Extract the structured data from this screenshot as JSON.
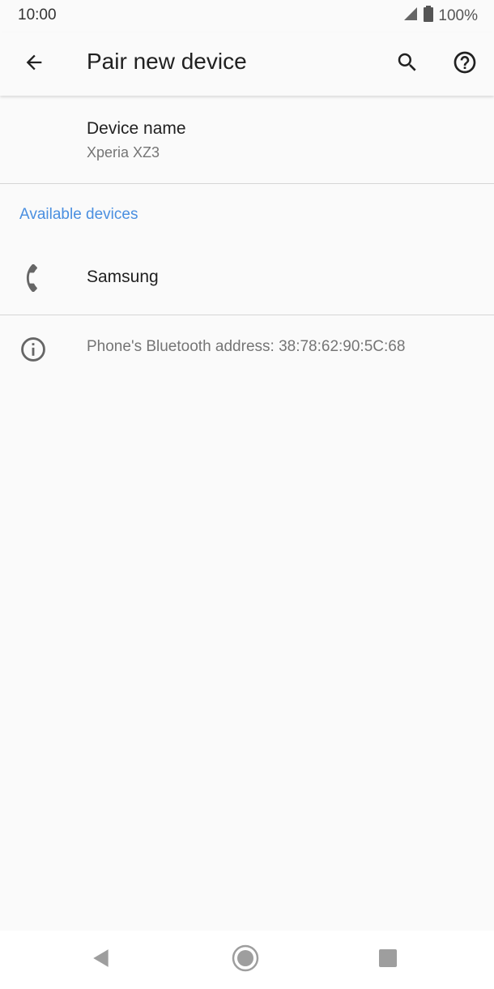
{
  "status_bar": {
    "time": "10:00",
    "battery": "100%",
    "signal_icon": "cell-signal-icon",
    "battery_icon": "battery-icon"
  },
  "app_bar": {
    "title": "Pair new device",
    "back_icon": "arrow-back-icon",
    "search_icon": "search-icon",
    "help_icon": "help-icon"
  },
  "device_name": {
    "label": "Device name",
    "value": "Xperia XZ3"
  },
  "available_devices": {
    "header": "Available devices",
    "devices": [
      {
        "name": "Samsung",
        "icon": "phone-icon"
      }
    ]
  },
  "bluetooth_info": {
    "icon": "info-icon",
    "text": "Phone's Bluetooth address: 38:78:62:90:5C:68"
  },
  "nav_bar": {
    "back": "nav-back-icon",
    "home": "nav-home-icon",
    "recents": "nav-recents-icon"
  },
  "colors": {
    "accent": "#4a8fe0",
    "background": "#fafafa",
    "text_primary": "#212121",
    "text_secondary": "#757575"
  }
}
